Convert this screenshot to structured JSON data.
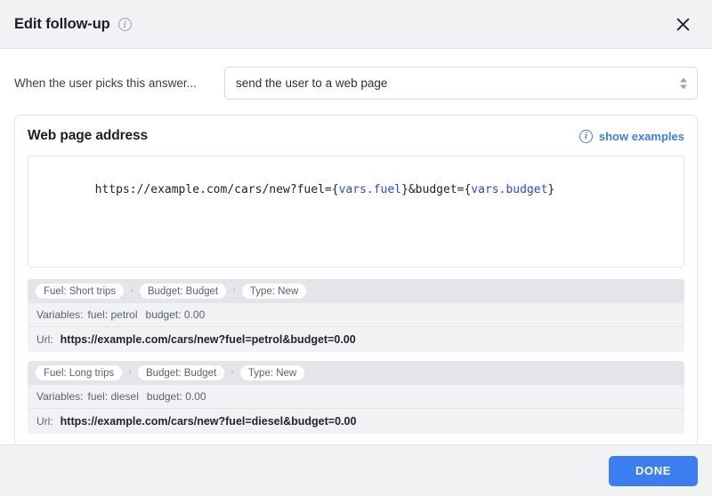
{
  "header": {
    "title": "Edit follow-up",
    "info_icon": "info-circle-icon",
    "info_glyph": "i",
    "close_icon": "close-x-icon"
  },
  "answer_row": {
    "label": "When the user picks this answer...",
    "select_value": "send the user to a web page",
    "stepper_icon": "up-down-chevron-icon"
  },
  "card": {
    "title": "Web page address",
    "show_examples_label": "show examples",
    "show_examples_icon": "info-circle-icon",
    "info_glyph": "i",
    "url_template": {
      "parts": [
        {
          "text": "https://example.com/cars/new?fuel=",
          "kind": "plain"
        },
        {
          "text": "{",
          "kind": "plain"
        },
        {
          "text": "vars.fuel",
          "kind": "variable"
        },
        {
          "text": "}&budget=",
          "kind": "plain"
        },
        {
          "text": "{",
          "kind": "plain"
        },
        {
          "text": "vars.budget",
          "kind": "variable"
        },
        {
          "text": "}",
          "kind": "plain"
        }
      ],
      "plain_text": "https://example.com/cars/new?fuel={vars.fuel}&budget={vars.budget}"
    }
  },
  "previews": [
    {
      "chips": [
        "Fuel: Short trips",
        "Budget: Budget",
        "Type: New"
      ],
      "chip_separator": "›",
      "variables_label": "Variables:",
      "variables": [
        "fuel: petrol",
        "budget: 0.00"
      ],
      "url_label": "Url:",
      "url_value": "https://example.com/cars/new?fuel=petrol&budget=0.00"
    },
    {
      "chips": [
        "Fuel: Long trips",
        "Budget: Budget",
        "Type: New"
      ],
      "chip_separator": "›",
      "variables_label": "Variables:",
      "variables": [
        "fuel: diesel",
        "budget: 0.00"
      ],
      "url_label": "Url:",
      "url_value": "https://example.com/cars/new?fuel=diesel&budget=0.00"
    }
  ],
  "footer": {
    "done_label": "DONE"
  },
  "colors": {
    "accent": "#3b7ef2",
    "variable_token": "#3243f5",
    "header_bg": "#f1f2f4",
    "chip_row_bg": "#e4e5ea",
    "row_bg": "#f1f2f4",
    "text": "#2b2f38",
    "muted_text": "#5b6170"
  }
}
